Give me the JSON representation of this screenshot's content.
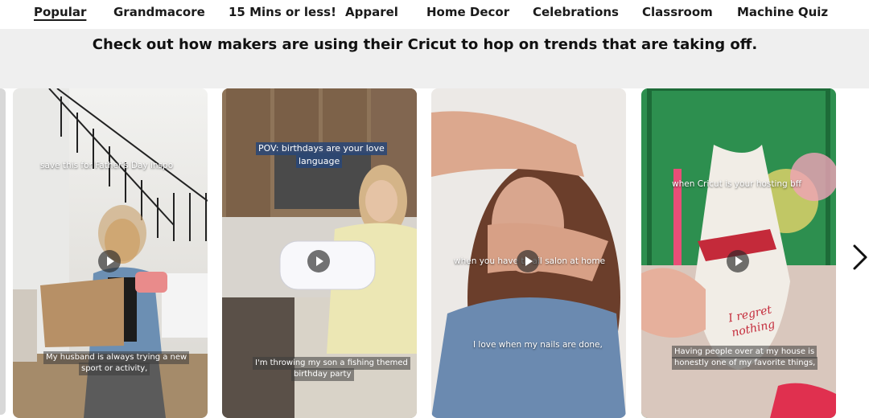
{
  "nav": {
    "items": [
      {
        "label": "Popular",
        "active": true
      },
      {
        "label": "Grandmacore"
      },
      {
        "label": "15 Mins or less!"
      },
      {
        "label": "Apparel"
      },
      {
        "label": "Home Decor"
      },
      {
        "label": "Celebrations"
      },
      {
        "label": "Classroom"
      },
      {
        "label": "Machine Quiz"
      }
    ]
  },
  "headline": "Check out how makers are using their Cricut to hop on trends that are taking off.",
  "cards": [
    {
      "top_caption": "save this for Father's Day inspo",
      "bottom_caption_line1": "My husband is always trying a new",
      "bottom_caption_line2": "sport or activity,"
    },
    {
      "top_caption_line1": "POV: birthdays are your love",
      "top_caption_line2": "language",
      "bottom_caption_line1": "I'm throwing my son a fishing themed",
      "bottom_caption_line2": "birthday party"
    },
    {
      "mid_caption": "when you have th    ail salon at home",
      "bottom_caption": "I love when my nails are done,"
    },
    {
      "top_caption": "when Cricut is your hosting bff",
      "napkin_text_line1": "I regret",
      "napkin_text_line2": "nothing",
      "bottom_caption_line1": "Having people over at my house is",
      "bottom_caption_line2": "honestly one of my favorite things,"
    }
  ],
  "icons": {
    "play": "play-icon",
    "next": "chevron-right-icon"
  }
}
